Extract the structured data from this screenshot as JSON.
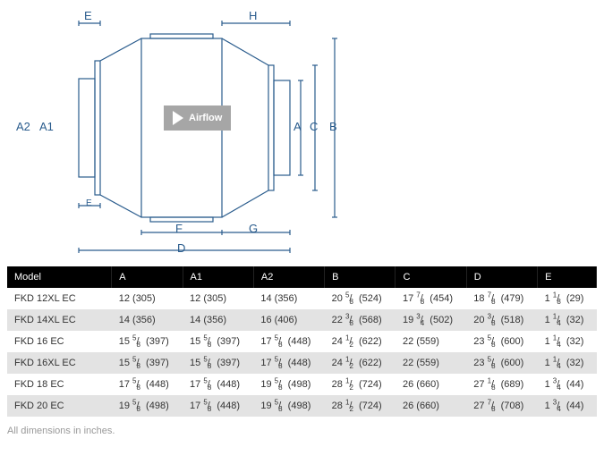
{
  "diagram": {
    "airflow_label": "Airflow",
    "dims": {
      "A": "A",
      "A1": "A1",
      "A2": "A2",
      "B": "B",
      "C": "C",
      "D": "D",
      "E_top": "E",
      "E_small": "E",
      "F": "F",
      "G": "G",
      "H": "H"
    }
  },
  "table": {
    "headers": [
      "Model",
      "A",
      "A1",
      "A2",
      "B",
      "C",
      "D",
      "E"
    ],
    "rows": [
      {
        "model": "FKD 12XL EC",
        "A": {
          "whole": "12",
          "num": "",
          "den": "",
          "mm": "305"
        },
        "A1": {
          "whole": "12",
          "num": "",
          "den": "",
          "mm": "305"
        },
        "A2": {
          "whole": "14",
          "num": "",
          "den": "",
          "mm": "356"
        },
        "B": {
          "whole": "20",
          "num": "5",
          "den": "8",
          "mm": "524"
        },
        "C": {
          "whole": "17",
          "num": "7",
          "den": "8",
          "mm": "454"
        },
        "D": {
          "whole": "18",
          "num": "7",
          "den": "8",
          "mm": "479"
        },
        "E": {
          "whole": "1",
          "num": "1",
          "den": "8",
          "mm": "29"
        }
      },
      {
        "model": "FKD 14XL EC",
        "A": {
          "whole": "14",
          "num": "",
          "den": "",
          "mm": "356"
        },
        "A1": {
          "whole": "14",
          "num": "",
          "den": "",
          "mm": "356"
        },
        "A2": {
          "whole": "16",
          "num": "",
          "den": "",
          "mm": "406"
        },
        "B": {
          "whole": "22",
          "num": "3",
          "den": "8",
          "mm": "568"
        },
        "C": {
          "whole": "19",
          "num": "3",
          "den": "4",
          "mm": "502"
        },
        "D": {
          "whole": "20",
          "num": "3",
          "den": "8",
          "mm": "518"
        },
        "E": {
          "whole": "1",
          "num": "1",
          "den": "4",
          "mm": "32"
        }
      },
      {
        "model": "FKD 16 EC",
        "A": {
          "whole": "15",
          "num": "5",
          "den": "8",
          "mm": "397"
        },
        "A1": {
          "whole": "15",
          "num": "5",
          "den": "8",
          "mm": "397"
        },
        "A2": {
          "whole": "17",
          "num": "5",
          "den": "8",
          "mm": "448"
        },
        "B": {
          "whole": "24",
          "num": "1",
          "den": "2",
          "mm": "622"
        },
        "C": {
          "whole": "22",
          "num": "",
          "den": "",
          "mm": "559"
        },
        "D": {
          "whole": "23",
          "num": "5",
          "den": "8",
          "mm": "600"
        },
        "E": {
          "whole": "1",
          "num": "1",
          "den": "4",
          "mm": "32"
        }
      },
      {
        "model": "FKD 16XL EC",
        "A": {
          "whole": "15",
          "num": "5",
          "den": "8",
          "mm": "397"
        },
        "A1": {
          "whole": "15",
          "num": "5",
          "den": "8",
          "mm": "397"
        },
        "A2": {
          "whole": "17",
          "num": "5",
          "den": "8",
          "mm": "448"
        },
        "B": {
          "whole": "24",
          "num": "1",
          "den": "2",
          "mm": "622"
        },
        "C": {
          "whole": "22",
          "num": "",
          "den": "",
          "mm": "559"
        },
        "D": {
          "whole": "23",
          "num": "5",
          "den": "8",
          "mm": "600"
        },
        "E": {
          "whole": "1",
          "num": "1",
          "den": "4",
          "mm": "32"
        }
      },
      {
        "model": "FKD 18 EC",
        "A": {
          "whole": "17",
          "num": "5",
          "den": "8",
          "mm": "448"
        },
        "A1": {
          "whole": "17",
          "num": "5",
          "den": "8",
          "mm": "448"
        },
        "A2": {
          "whole": "19",
          "num": "5",
          "den": "8",
          "mm": "498"
        },
        "B": {
          "whole": "28",
          "num": "1",
          "den": "2",
          "mm": "724"
        },
        "C": {
          "whole": "26",
          "num": "",
          "den": "",
          "mm": "660"
        },
        "D": {
          "whole": "27",
          "num": "1",
          "den": "8",
          "mm": "689"
        },
        "E": {
          "whole": "1",
          "num": "3",
          "den": "4",
          "mm": "44"
        }
      },
      {
        "model": "FKD 20 EC",
        "A": {
          "whole": "19",
          "num": "5",
          "den": "8",
          "mm": "498"
        },
        "A1": {
          "whole": "17",
          "num": "5",
          "den": "8",
          "mm": "448"
        },
        "A2": {
          "whole": "19",
          "num": "5",
          "den": "8",
          "mm": "498"
        },
        "B": {
          "whole": "28",
          "num": "1",
          "den": "2",
          "mm": "724"
        },
        "C": {
          "whole": "26",
          "num": "",
          "den": "",
          "mm": "660"
        },
        "D": {
          "whole": "27",
          "num": "7",
          "den": "8",
          "mm": "708"
        },
        "E": {
          "whole": "1",
          "num": "3",
          "den": "4",
          "mm": "44"
        }
      }
    ]
  },
  "note": "All dimensions in inches."
}
